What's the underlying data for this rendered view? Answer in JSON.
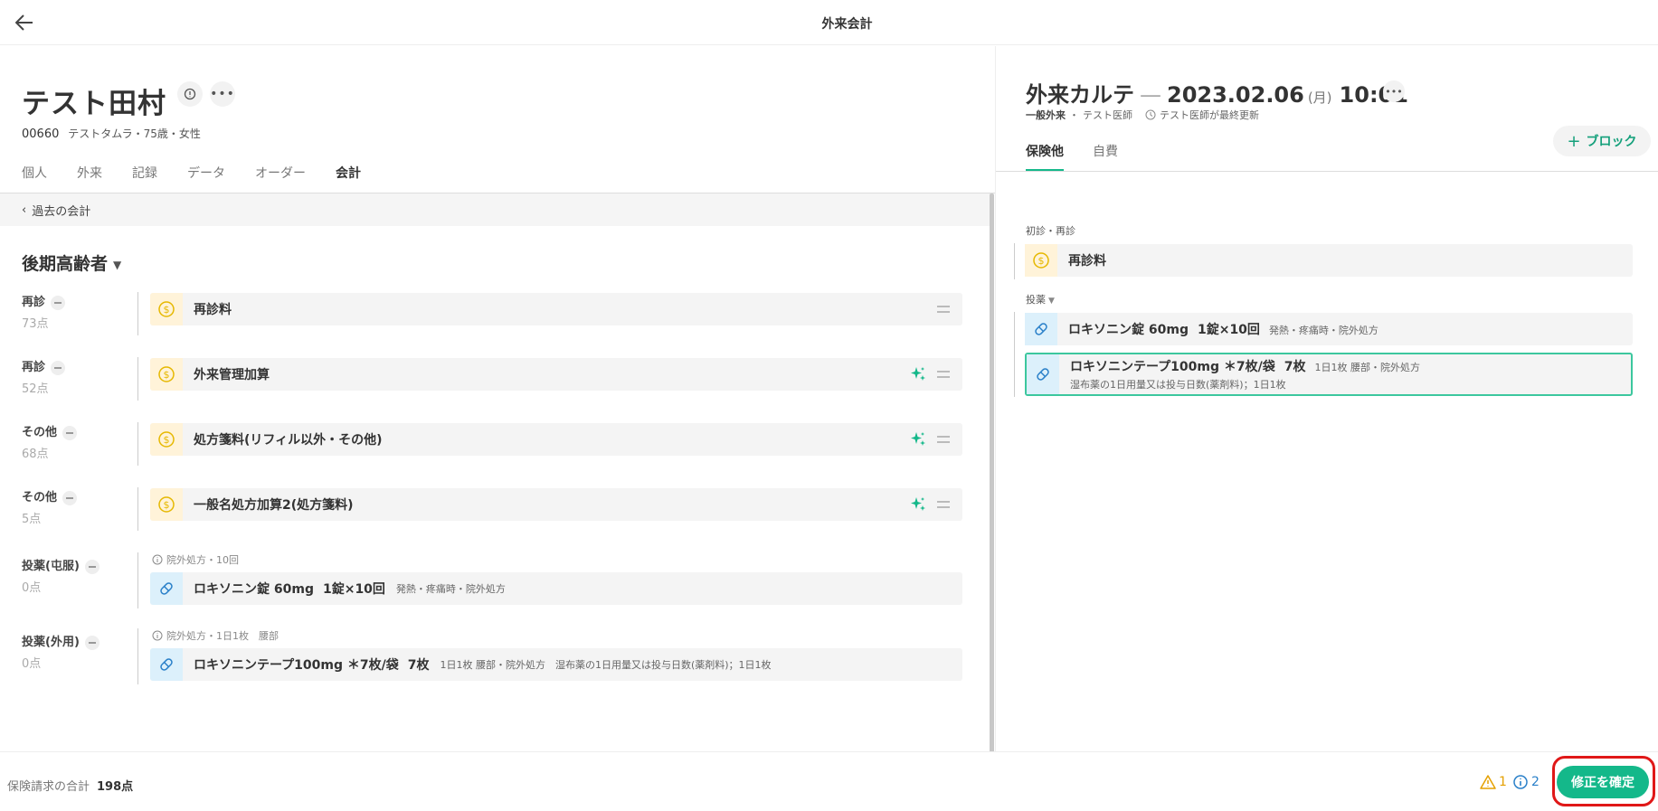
{
  "header": {
    "title": "外来会計"
  },
  "patient": {
    "name": "テスト田村",
    "id": "00660",
    "info": "テストタムラ・75歳・女性"
  },
  "tabs": [
    "個人",
    "外来",
    "記録",
    "データ",
    "オーダー",
    "会計"
  ],
  "active_tab": "会計",
  "past_link": "過去の会計",
  "insurance_section": "後期高齢者",
  "billing_rows": [
    {
      "category": "再診",
      "points": "73点",
      "item": "再診料",
      "icon": "coin-icon"
    },
    {
      "category": "再診",
      "points": "52点",
      "item": "外来管理加算",
      "icon": "coin-icon"
    },
    {
      "category": "その他",
      "points": "68点",
      "item": "処方箋料(リフィル以外・その他)",
      "icon": "coin-icon"
    },
    {
      "category": "その他",
      "points": "5点",
      "item": "一般名処方加算2(処方箋料)",
      "icon": "coin-icon"
    },
    {
      "category": "投薬(屯服)",
      "points": "0点",
      "note": "院外処方・10回",
      "item": "ロキソニン錠 60mg",
      "dose": "1錠×10回",
      "sub": "発熱・疼痛時・院外処方",
      "icon": "pill-icon"
    },
    {
      "category": "投薬(外用)",
      "points": "0点",
      "note": "院外処方・1日1枚　腰部",
      "item": "ロキソニンテープ100mg ＊7枚/袋",
      "dose": "7枚",
      "sub": "1日1枚 腰部・院外処方　湿布薬の1日用量又は投与日数(薬剤料)；1日1枚",
      "icon": "pill-icon"
    }
  ],
  "karte": {
    "title": "外来カルテ",
    "dash": "—",
    "date": "2023.02.06",
    "dow": "(月)",
    "time": "10:01",
    "dept": "一般外来",
    "doctor": "テスト医師",
    "updated_by": "テスト医師",
    "updated_suffix": "が最終更新",
    "block_button": "ブロック",
    "tabs": [
      "保険他",
      "自費"
    ],
    "groups": {
      "first": "初診・再診",
      "first_item": "再診料",
      "med": "投薬",
      "med_items": [
        {
          "name": "ロキソニン錠 60mg",
          "dose": "1錠×10回",
          "sub": "発熱・疼痛時・院外処方"
        },
        {
          "name": "ロキソニンテープ100mg ＊7枚/袋",
          "dose": "7枚",
          "sub": "1日1枚 腰部・院外処方",
          "line2": "湿布薬の1日用量又は投与日数(薬剤料)；1日1枚"
        }
      ]
    }
  },
  "footer": {
    "total_label": "保険請求の合計",
    "total_value": "198点",
    "warning_count": "1",
    "info_count": "2",
    "confirm_button": "修正を確定"
  },
  "colors": {
    "accent": "#14b88a",
    "warning": "#e5a000",
    "info": "#2a80c9",
    "highlight": "#e01818"
  }
}
